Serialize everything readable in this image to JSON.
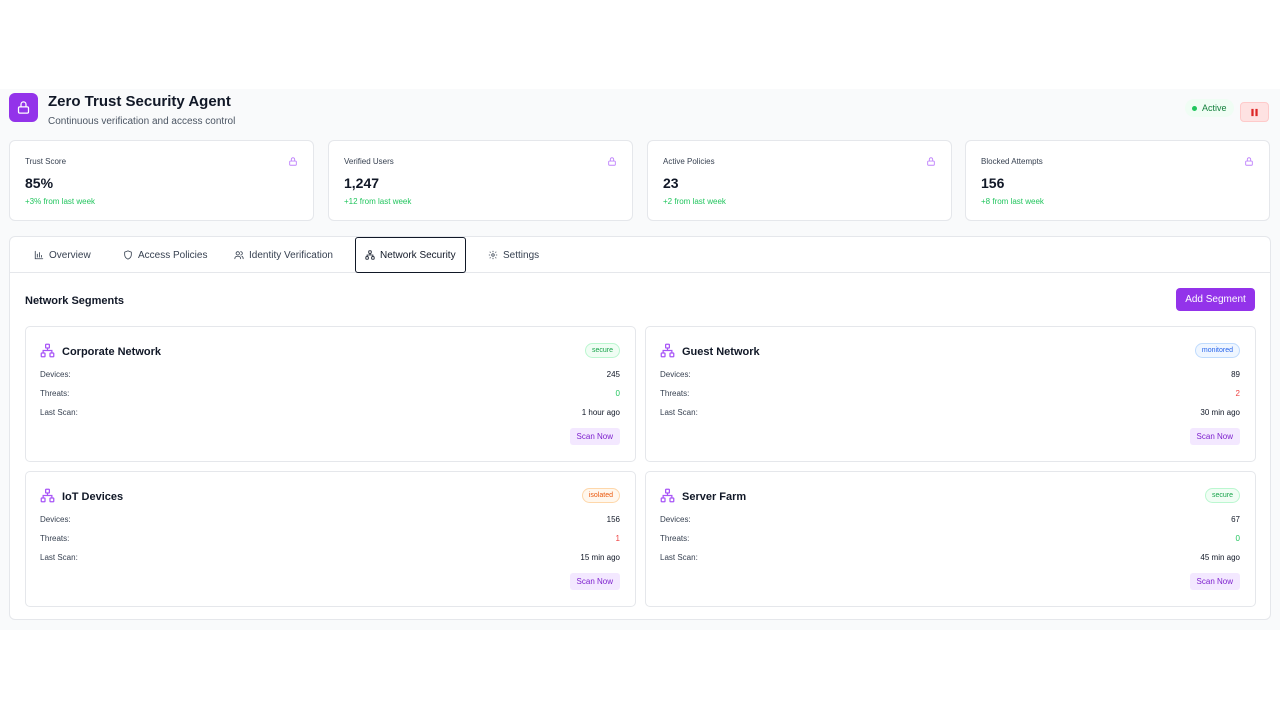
{
  "header": {
    "title": "Zero Trust Security Agent",
    "subtitle": "Continuous verification and access control",
    "status": "Active",
    "logo_icon": "lock-icon",
    "pause_icon": "pause-icon"
  },
  "colors": {
    "accent": "#9333ea",
    "success": "#22c55e",
    "danger": "#ef4444",
    "warning": "#ea580c",
    "info": "#2563eb"
  },
  "stats": [
    {
      "label": "Trust Score",
      "value": "85%",
      "change": "+3% from last week",
      "icon": "lock-icon"
    },
    {
      "label": "Verified Users",
      "value": "1,247",
      "change": "+12 from last week",
      "icon": "lock-icon"
    },
    {
      "label": "Active Policies",
      "value": "23",
      "change": "+2 from last week",
      "icon": "lock-icon"
    },
    {
      "label": "Blocked Attempts",
      "value": "156",
      "change": "+8 from last week",
      "icon": "lock-icon"
    }
  ],
  "tabs": [
    {
      "label": "Overview",
      "icon": "bar-chart-icon"
    },
    {
      "label": "Access Policies",
      "icon": "shield-icon"
    },
    {
      "label": "Identity Verification",
      "icon": "users-icon"
    },
    {
      "label": "Network Security",
      "icon": "network-icon",
      "active": true
    },
    {
      "label": "Settings",
      "icon": "gear-icon"
    }
  ],
  "network": {
    "section_title": "Network Segments",
    "add_label": "Add Segment",
    "row_labels": {
      "devices": "Devices:",
      "threats": "Threats:",
      "last_scan": "Last Scan:"
    },
    "scan_label": "Scan Now",
    "segments": [
      {
        "name": "Corporate Network",
        "status": "secure",
        "devices": "245",
        "threats": "0",
        "last_scan": "1 hour ago"
      },
      {
        "name": "Guest Network",
        "status": "monitored",
        "devices": "89",
        "threats": "2",
        "last_scan": "30 min ago"
      },
      {
        "name": "IoT Devices",
        "status": "isolated",
        "devices": "156",
        "threats": "1",
        "last_scan": "15 min ago"
      },
      {
        "name": "Server Farm",
        "status": "secure",
        "devices": "67",
        "threats": "0",
        "last_scan": "45 min ago"
      }
    ]
  }
}
